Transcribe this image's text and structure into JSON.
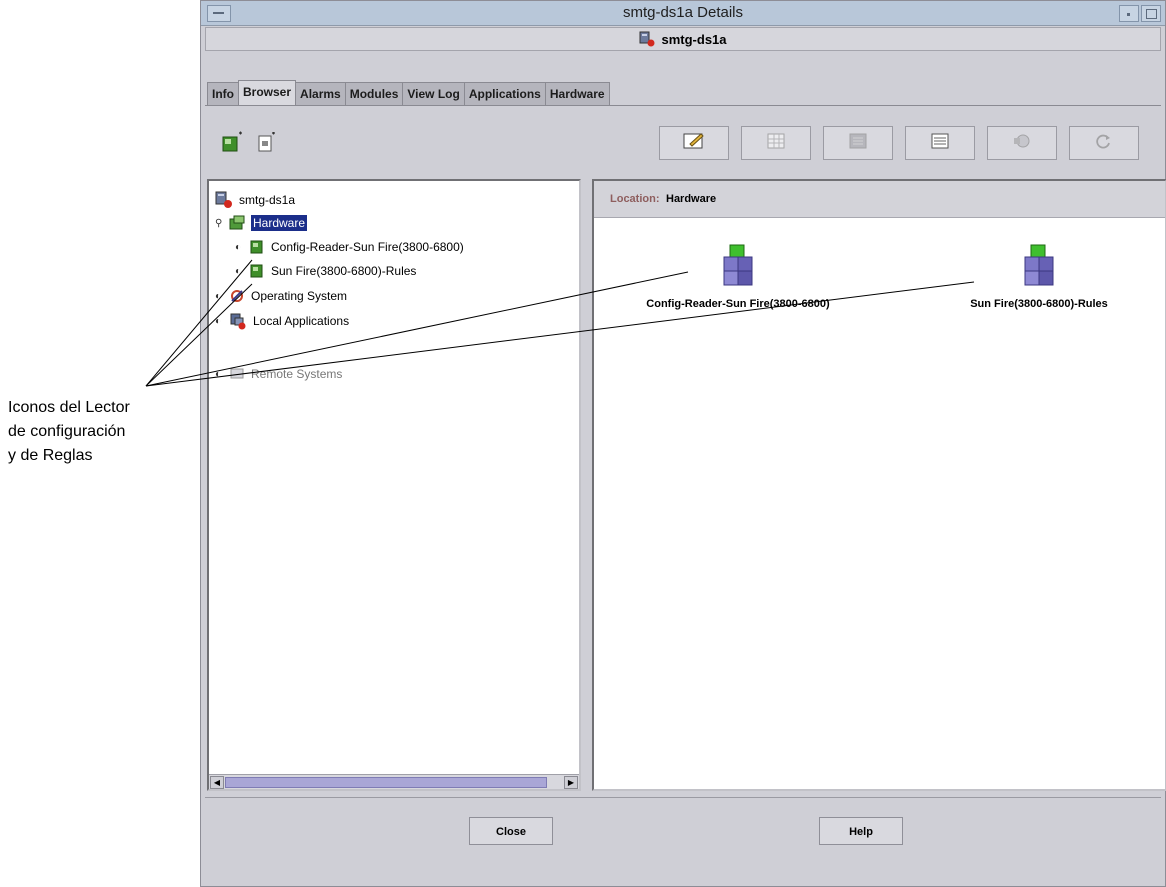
{
  "window": {
    "title": "smtg-ds1a Details",
    "hostname": "smtg-ds1a"
  },
  "tabs": [
    {
      "label": "Info"
    },
    {
      "label": "Browser",
      "active": true
    },
    {
      "label": "Alarms"
    },
    {
      "label": "Modules"
    },
    {
      "label": "View Log"
    },
    {
      "label": "Applications"
    },
    {
      "label": "Hardware"
    }
  ],
  "toolbar": {
    "buttons": [
      {
        "name": "properties-button",
        "icon": "edit-note-icon",
        "enabled": true
      },
      {
        "name": "table-button",
        "icon": "grid-table-icon",
        "enabled": false
      },
      {
        "name": "list-button",
        "icon": "list-view-icon",
        "enabled": false
      },
      {
        "name": "details-button",
        "icon": "details-view-icon",
        "enabled": true
      },
      {
        "name": "tools-button",
        "icon": "tools-icon",
        "enabled": false
      },
      {
        "name": "refresh-button",
        "icon": "refresh-icon",
        "enabled": false
      }
    ]
  },
  "tree": {
    "root": "smtg-ds1a",
    "hardware": "Hardware",
    "config_reader": "Config-Reader-Sun Fire(3800-6800)",
    "rules": "Sun Fire(3800-6800)-Rules",
    "os": "Operating System",
    "local_apps": "Local Applications",
    "remote_systems": "Remote Systems"
  },
  "content": {
    "location_label": "Location:",
    "location_value": "Hardware",
    "objects": [
      {
        "label": "Config-Reader-Sun Fire(3800-6800)"
      },
      {
        "label": "Sun Fire(3800-6800)-Rules"
      }
    ]
  },
  "buttons": {
    "close": "Close",
    "help": "Help"
  },
  "callout": {
    "line1": "Iconos del Lector",
    "line2": "de configuración",
    "line3": "y de Reglas"
  }
}
